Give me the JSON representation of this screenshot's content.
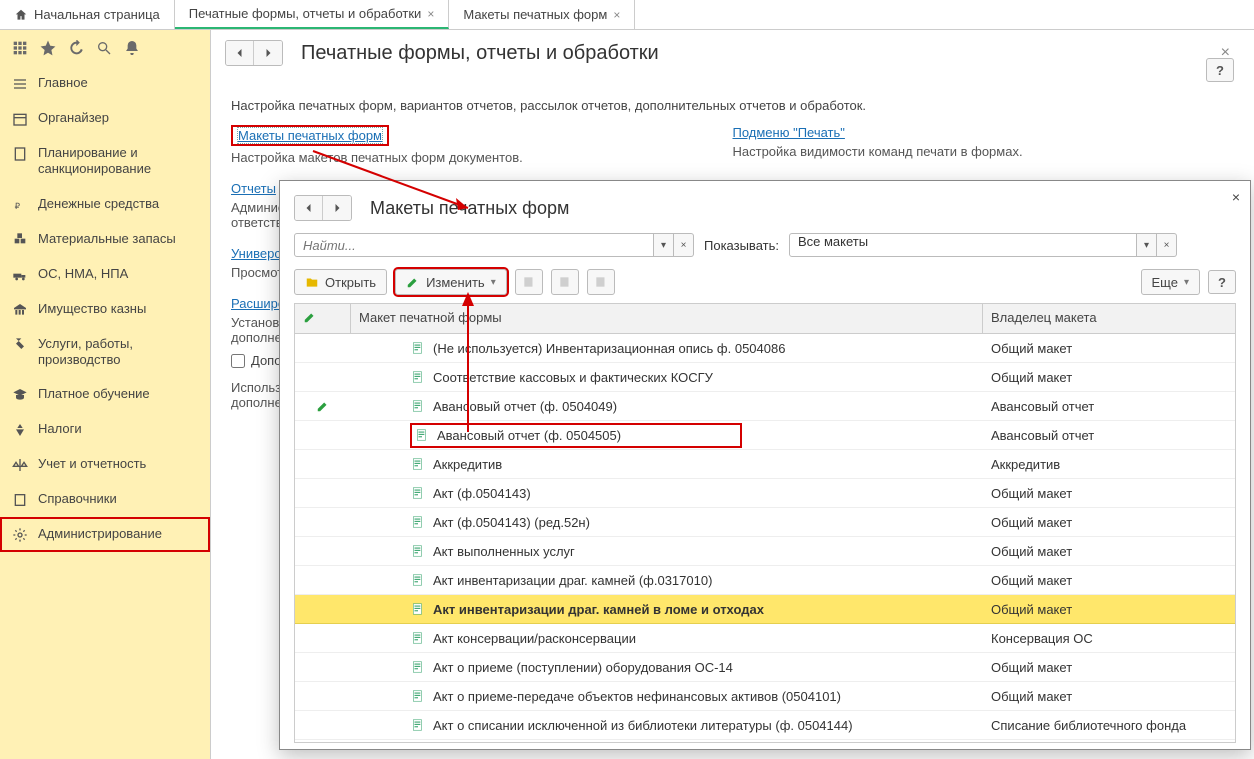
{
  "tabs": [
    {
      "label": "Начальная страница",
      "closable": false,
      "icon": "home"
    },
    {
      "label": "Печатные формы, отчеты и обработки",
      "closable": true,
      "active": true
    },
    {
      "label": "Макеты печатных форм",
      "closable": true
    }
  ],
  "sidebar": {
    "items": [
      {
        "label": "Главное",
        "icon": "menu"
      },
      {
        "label": "Органайзер",
        "icon": "calendar"
      },
      {
        "label": "Планирование и санкционирование",
        "icon": "doc"
      },
      {
        "label": "Денежные средства",
        "icon": "ruble"
      },
      {
        "label": "Материальные запасы",
        "icon": "boxes"
      },
      {
        "label": "ОС, НМА, НПА",
        "icon": "truck"
      },
      {
        "label": "Имущество казны",
        "icon": "bank"
      },
      {
        "label": "Услуги, работы, производство",
        "icon": "tools"
      },
      {
        "label": "Платное обучение",
        "icon": "grad"
      },
      {
        "label": "Налоги",
        "icon": "eagle"
      },
      {
        "label": "Учет и отчетность",
        "icon": "scales"
      },
      {
        "label": "Справочники",
        "icon": "book"
      },
      {
        "label": "Администрирование",
        "icon": "gear",
        "active": true
      }
    ]
  },
  "main": {
    "title": "Печатные формы, отчеты и обработки",
    "descr": "Настройка печатных форм, вариантов отчетов, рассылок отчетов, дополнительных отчетов и обработок.",
    "help": "?",
    "col1": {
      "link1": "Макеты печатных форм",
      "sub1": "Настройка макетов печатных форм документов.",
      "link2": "Отчеты",
      "sub2": "Администр\nответстве",
      "link3": "Универса",
      "sub3": "Просмотр",
      "link4": "Расшире",
      "sub4": "Установка\nдополнен",
      "check": "Дополни",
      "sub5": "Использо\nдополнен"
    },
    "col2": {
      "link1": "Подменю \"Печать\"",
      "sub1": "Настройка видимости команд печати в формах."
    }
  },
  "popup": {
    "title": "Макеты печатных форм",
    "find_placeholder": "Найти...",
    "show_label": "Показывать:",
    "show_value": "Все макеты",
    "open_btn": "Открыть",
    "edit_btn": "Изменить",
    "more_btn": "Еще",
    "help_btn": "?",
    "col_template": "Макет печатной формы",
    "col_owner": "Владелец макета",
    "rows": [
      {
        "name": "(Не используется) Инвентаризационная опись ф. 0504086",
        "owner": "Общий макет"
      },
      {
        "name": "Соответствие кассовых и фактических КОСГУ",
        "owner": "Общий макет"
      },
      {
        "name": "Авансовый отчет (ф. 0504049)",
        "owner": "Авансовый отчет",
        "edited": true
      },
      {
        "name": "Авансовый отчет (ф. 0504505)",
        "owner": "Авансовый отчет",
        "boxed": true
      },
      {
        "name": "Аккредитив",
        "owner": "Аккредитив"
      },
      {
        "name": "Акт (ф.0504143)",
        "owner": "Общий макет"
      },
      {
        "name": "Акт (ф.0504143) (ред.52н)",
        "owner": "Общий макет"
      },
      {
        "name": "Акт выполненных услуг",
        "owner": "Общий макет"
      },
      {
        "name": "Акт инвентаризации драг. камней (ф.0317010)",
        "owner": "Общий макет"
      },
      {
        "name": "Акт инвентаризации драг. камней в ломе и отходах",
        "owner": "Общий макет",
        "selected": true,
        "bold": true
      },
      {
        "name": "Акт консервации/расконсервации",
        "owner": "Консервация ОС"
      },
      {
        "name": "Акт о приеме (поступлении) оборудования ОС-14",
        "owner": "Общий макет"
      },
      {
        "name": "Акт о приеме-передаче объектов нефинансовых активов (0504101)",
        "owner": "Общий макет"
      },
      {
        "name": "Акт о списании исключенной из библиотеки литературы (ф. 0504144)",
        "owner": "Списание библиотечного фонда"
      }
    ]
  }
}
